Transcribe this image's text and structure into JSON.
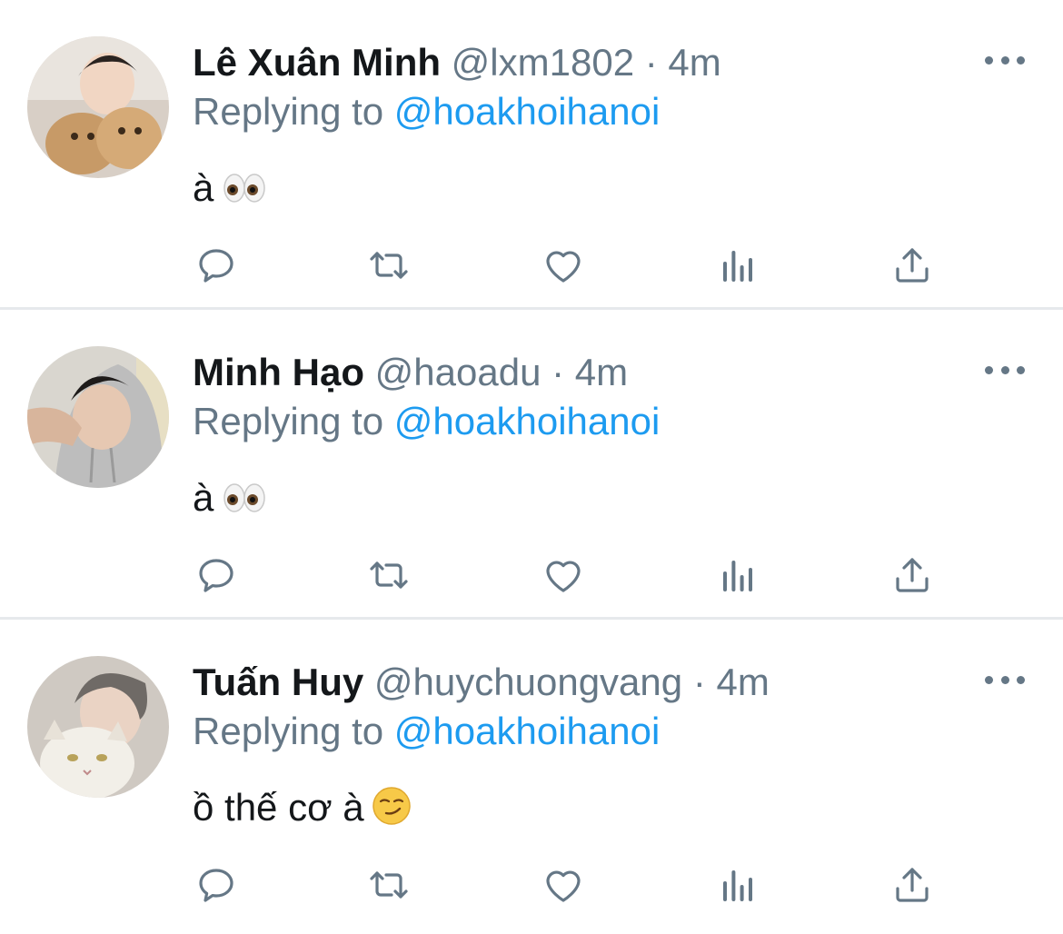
{
  "tweets": [
    {
      "name": "Lê Xuân Minh",
      "handle": "@lxm1802",
      "separator": "·",
      "time": "4m",
      "replying_prefix": "Replying to",
      "replying_to": "@hoakhoihanoi",
      "text": "à",
      "emoji": "eyes"
    },
    {
      "name": "Minh Hạo",
      "handle": "@haoadu",
      "separator": "·",
      "time": "4m",
      "replying_prefix": "Replying to",
      "replying_to": "@hoakhoihanoi",
      "text": "à",
      "emoji": "eyes"
    },
    {
      "name": "Tuấn Huy",
      "handle": "@huychuongvang",
      "separator": "·",
      "time": "4m",
      "replying_prefix": "Replying to",
      "replying_to": "@hoakhoihanoi",
      "text": "ồ thế cơ à",
      "emoji": "smirking-face"
    }
  ],
  "actions": [
    "reply-icon",
    "retweet-icon",
    "like-icon",
    "views-icon",
    "share-icon"
  ],
  "colors": {
    "text": "#14171a",
    "secondary": "#657786",
    "accent": "#1d9bf0",
    "divider": "#e6e9ec"
  }
}
